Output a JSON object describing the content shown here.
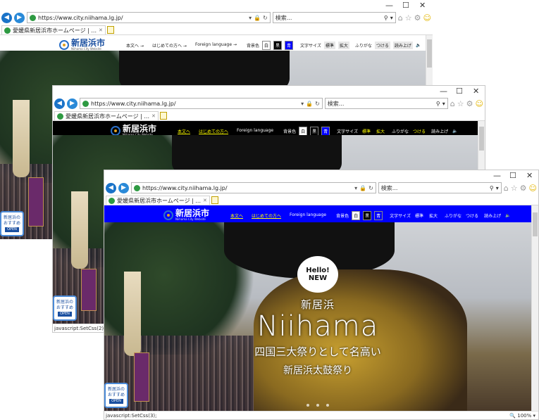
{
  "browser": {
    "url": "https://www.city.niihama.lg.jp/",
    "search_placeholder": "検索...",
    "tab_title": "愛媛県新居浜市ホームページ | ...",
    "title_controls": [
      "—",
      "☐",
      "✕"
    ]
  },
  "site": {
    "logo_jp": "新居浜市",
    "logo_en": "Niihama City Website",
    "nav": [
      "本文へ",
      "はじめての方へ",
      "Foreign language"
    ],
    "nav_arrow": "→",
    "bg_color_label": "背景色",
    "bg_white": "白",
    "bg_black": "黒",
    "bg_blue": "青",
    "font_size_label": "文字サイズ",
    "font_standard": "標準",
    "font_large": "拡大",
    "furigana_label": "ふりがな",
    "furigana_on": "つける",
    "read_aloud": "読み上げ"
  },
  "hero": {
    "bubble_line1": "Hello!",
    "bubble_line2": "NEW",
    "jp_title": "新居浜",
    "en_title": "Niihama",
    "subtitle": "四国三大祭りとして名高い",
    "subtitle2": "新居浜太鼓祭り"
  },
  "recommend": {
    "line1": "新居浜の",
    "line2": "おすすめ",
    "open": "OPEN"
  },
  "status": {
    "w2": "javascript:SetCss(2);",
    "w3": "javascript:SetCss(3);",
    "zoom": "🔍 100%",
    "zoom_arrow": "▾"
  },
  "theme": {
    "white": "#ffffff",
    "black": "#000000",
    "blue": "#0000ff",
    "highlight": "#ffff00"
  }
}
